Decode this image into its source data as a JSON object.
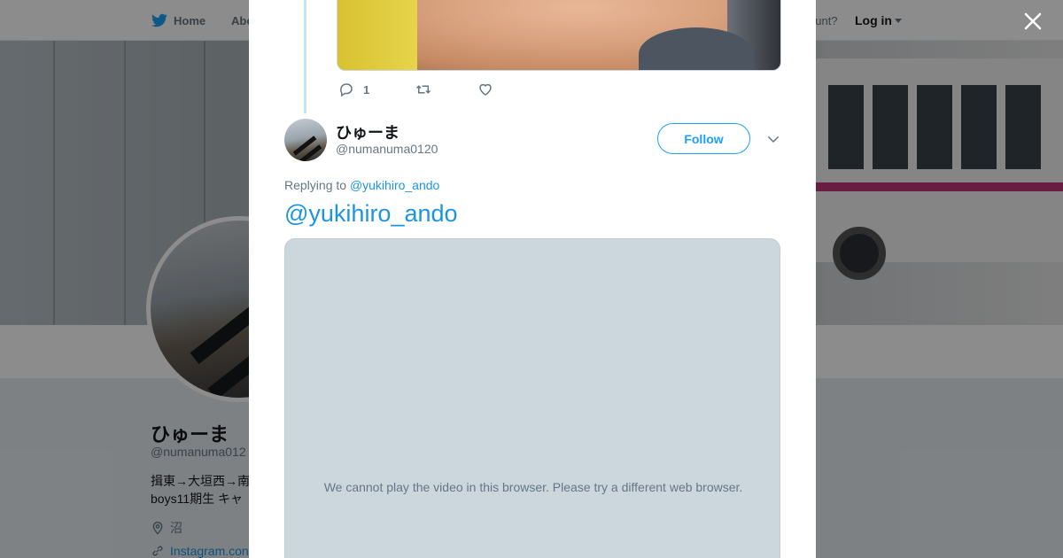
{
  "nav": {
    "home_label": "Home",
    "about_label": "Abo",
    "account_prompt": "ccount?",
    "login_label": "Log in"
  },
  "profile": {
    "name": "ひゅーま",
    "handle": "@numanuma012",
    "bio_line1": "揖東→大垣西→南",
    "bio_line2": "boys11期生 キャ",
    "location": "沼",
    "link": "Instagram.con"
  },
  "previous_tweet": {
    "reply_count": "1"
  },
  "tweet": {
    "display_name": "ひゅーま",
    "handle": "@numanuma0120",
    "follow_label": "Follow",
    "replying_prefix": "Replying to",
    "replying_to": "@yukihiro_ando",
    "text": "@yukihiro_ando",
    "video_message": "We cannot play the video in this browser. Please try a different web browser."
  },
  "colors": {
    "twitter_blue": "#1da1f2",
    "link_blue": "#1b95e0",
    "secondary_text": "#657786"
  },
  "icons": {
    "nav_logo": "twitter-bird-icon",
    "close": "close-icon",
    "reply": "reply-icon",
    "retweet": "retweet-icon",
    "like": "heart-icon",
    "more": "chevron-down-icon",
    "location": "location-pin-icon",
    "link": "link-icon"
  }
}
